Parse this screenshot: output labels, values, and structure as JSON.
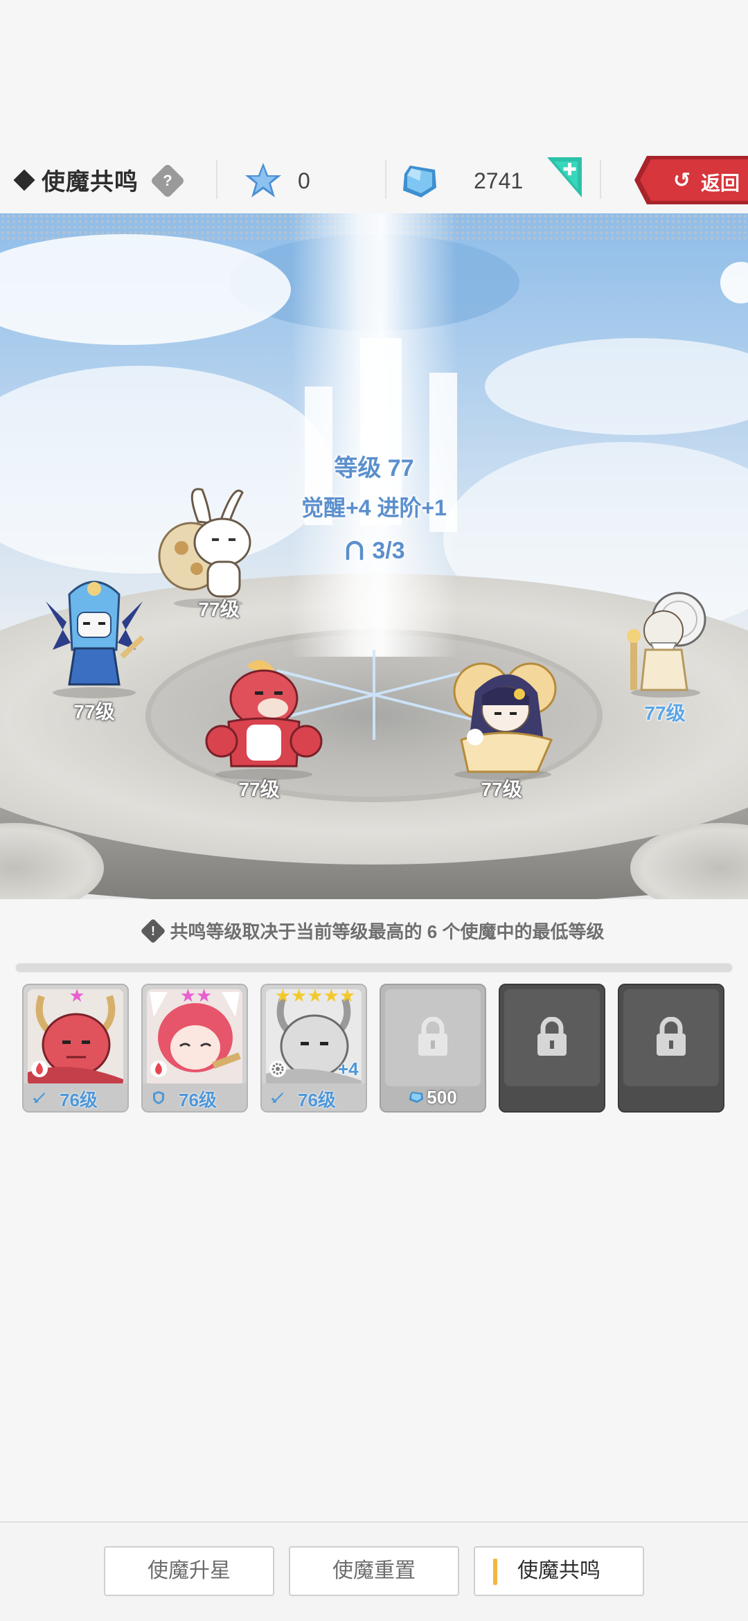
{
  "header": {
    "title": "使魔共鸣",
    "help_glyph": "?",
    "star_currency": "0",
    "gem_currency": "2741",
    "back_label": "返回",
    "back_arrow": "↺"
  },
  "scene": {
    "level_text": "等级 77",
    "awaken_text": "觉醒+4   进阶+1",
    "ratio_text": "3/3",
    "characters": [
      {
        "name": "rabbit",
        "level": "77级"
      },
      {
        "name": "blue-pharaoh",
        "level": "77级"
      },
      {
        "name": "red-bear",
        "level": "77级"
      },
      {
        "name": "dark-hair-girl",
        "level": "77级"
      },
      {
        "name": "old-sage",
        "level": "77级"
      }
    ]
  },
  "notice": {
    "icon_glyph": "!",
    "text": "共鸣等级取决于当前等级最高的 6 个使魔中的最低等级"
  },
  "slots": [
    {
      "stars": "★",
      "star_color": "#e85fd0",
      "level": "76级",
      "class_icon": "sword-icon",
      "element_icon": "fire-icon"
    },
    {
      "stars": "★★",
      "star_color": "#e85fd0",
      "level": "76级",
      "class_icon": "shield-icon",
      "element_icon": "fire-icon"
    },
    {
      "stars": "★★★★★",
      "star_color": "#f3c92a",
      "level": "76级",
      "class_icon": "sword-icon",
      "element_icon": "gear-icon",
      "bonus": "+4"
    },
    {
      "locked": true,
      "cost": "500"
    },
    {
      "locked": true
    },
    {
      "locked": true
    }
  ],
  "tabs": [
    {
      "label": "使魔升星",
      "active": false
    },
    {
      "label": "使魔重置",
      "active": false
    },
    {
      "label": "使魔共鸣",
      "active": true
    }
  ],
  "colors": {
    "accent_blue": "#5b8fcd",
    "back_red": "#d6363c",
    "tab_accent": "#f3b63e"
  }
}
